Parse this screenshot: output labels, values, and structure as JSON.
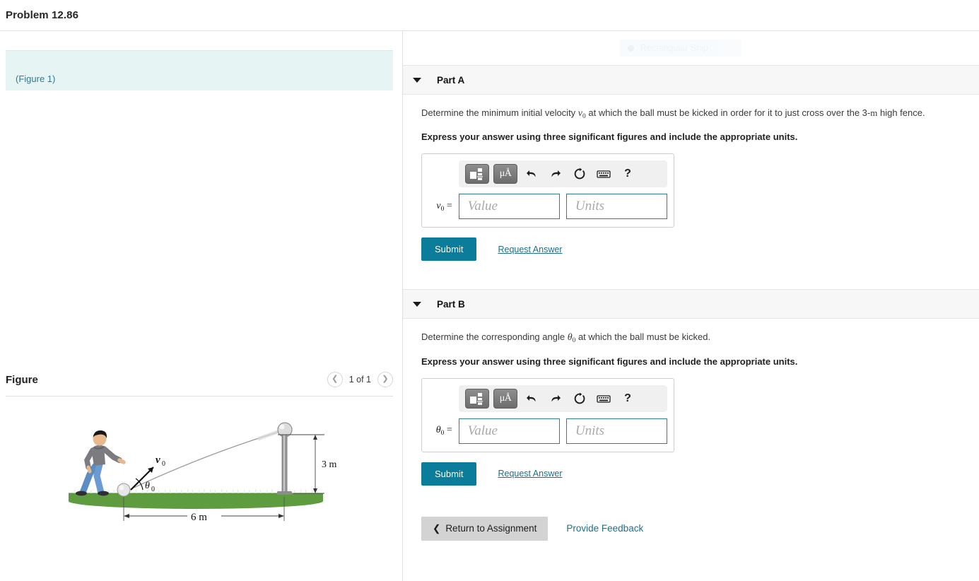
{
  "header": {
    "problem_title": "Problem 12.86"
  },
  "left_pane": {
    "figure_link": "(Figure 1)",
    "figure_heading": "Figure",
    "nav": {
      "prev_icon": "chevron-left-icon",
      "next_icon": "chevron-right-icon",
      "count_label": "1 of 1"
    }
  },
  "snip_overlay": {
    "label": "Rectangular Snip"
  },
  "figure_art": {
    "velocity_label": "v",
    "velocity_sub": "0",
    "angle_label": "θ",
    "angle_sub": "0",
    "height_label": "3 m",
    "distance_label": "6 m",
    "colors": {
      "grass": "#5e9c3f",
      "grass_dark": "#3d7a25",
      "shirt": "#7c7c80",
      "jeans": "#6b9bd2",
      "hair": "#1a1a1a",
      "skin": "#e8b98d",
      "ball": "#e0e0e0",
      "post": "#8c8c8c"
    }
  },
  "toolbar": {
    "template_icon": "math-template-icon",
    "units_icon": "micro-angstrom-icon",
    "units_label": "μÅ",
    "undo_icon": "undo-arrow-icon",
    "redo_icon": "redo-arrow-icon",
    "reset_icon": "reset-circle-icon",
    "keyboard_icon": "keyboard-icon",
    "help_icon": "question-mark-icon",
    "help_label": "?"
  },
  "parts": [
    {
      "id": "part-a",
      "label": "Part A",
      "prompt_pre": "Determine the minimum initial velocity ",
      "prompt_var": "v",
      "prompt_var_sub": "0",
      "prompt_mid": " at which the ball must be kicked in order for it to just cross over the 3-",
      "prompt_unit": "m",
      "prompt_post": " high fence.",
      "instruction": "Express your answer using three significant figures and include the appropriate units.",
      "answer_var": "v",
      "answer_var_sub": "0",
      "answer_eq": "=",
      "value_placeholder": "Value",
      "units_placeholder": "Units",
      "value_current": "",
      "units_current": "",
      "submit_label": "Submit",
      "request_label": "Request Answer"
    },
    {
      "id": "part-b",
      "label": "Part B",
      "prompt_pre": "Determine the corresponding angle ",
      "prompt_var": "θ",
      "prompt_var_sub": "0",
      "prompt_mid": " at which the ball must be kicked.",
      "prompt_unit": "",
      "prompt_post": "",
      "instruction": "Express your answer using three significant figures and include the appropriate units.",
      "answer_var": "θ",
      "answer_var_sub": "0",
      "answer_eq": "=",
      "value_placeholder": "Value",
      "units_placeholder": "Units",
      "value_current": "",
      "units_current": "",
      "submit_label": "Submit",
      "request_label": "Request Answer"
    }
  ],
  "footer": {
    "return_label": "Return to Assignment",
    "return_icon": "chevron-left-icon",
    "feedback_label": "Provide Feedback"
  },
  "colors": {
    "accent_teal": "#0b7c99",
    "link_teal": "#1d6f8b",
    "callout_bg": "#e7f4f4",
    "part_header_bg": "#f7f7f7"
  }
}
